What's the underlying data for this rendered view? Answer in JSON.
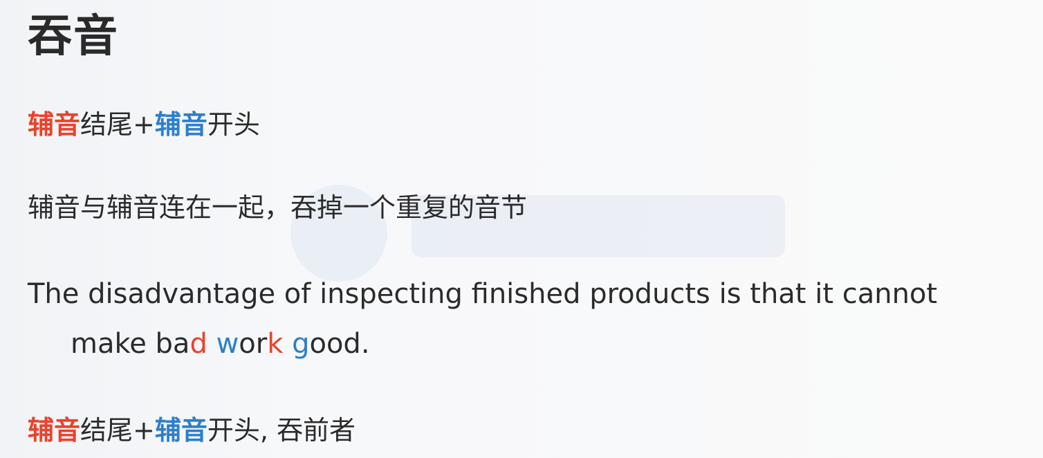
{
  "title": "吞音",
  "rule1": {
    "part1_red": "辅音",
    "part2": "结尾+",
    "part3_blue": "辅音",
    "part4": "开头"
  },
  "explanation": "辅音与辅音连在一起，吞掉一个重复的音节",
  "example": {
    "line1": "The disadvantage of inspecting finished products is that it cannot",
    "line2_segments": {
      "s1": "make ba",
      "s2_red": "d",
      "s3": " ",
      "s4_blue": "w",
      "s5": "or",
      "s6_red": "k",
      "s7": " ",
      "s8_blue": "g",
      "s9": "ood."
    }
  },
  "rule2": {
    "part1_red": "辅音",
    "part2": "结尾+",
    "part3_blue": "辅音",
    "part4": "开头, 吞前者"
  },
  "colors": {
    "red": "#e8432b",
    "blue": "#2d7fc9",
    "text": "#2b2b2b",
    "background": "#f6f7f9"
  },
  "watermark": {
    "icon": "logo-watermark"
  }
}
